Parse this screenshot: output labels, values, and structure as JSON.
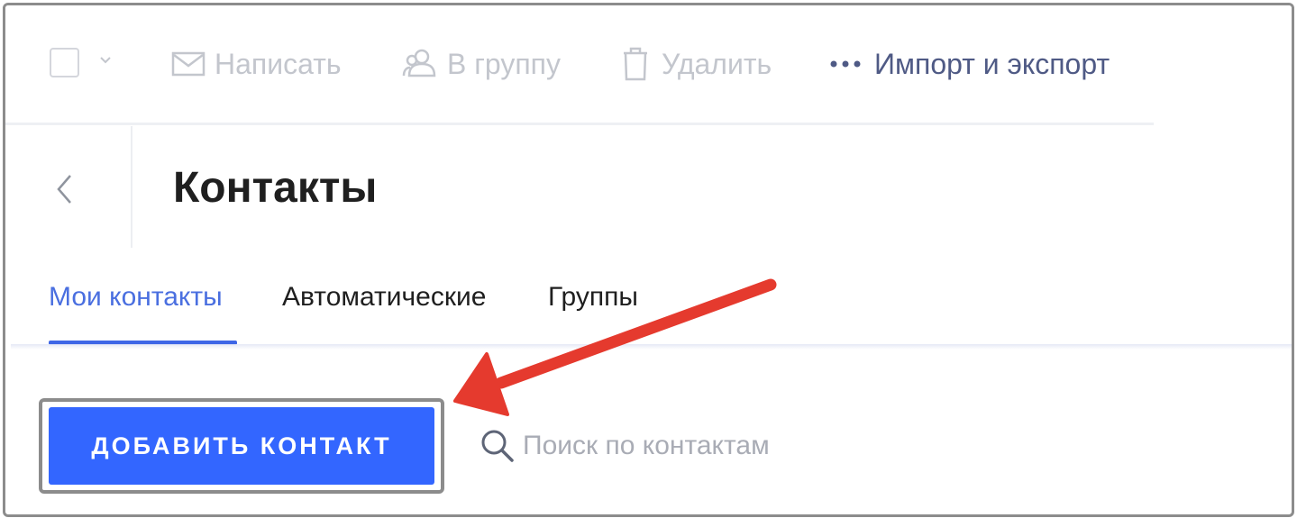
{
  "toolbar": {
    "compose_label": "Написать",
    "to_group_label": "В группу",
    "delete_label": "Удалить",
    "import_export_label": "Импорт и экспорт"
  },
  "header": {
    "title": "Контакты"
  },
  "tabs": [
    {
      "label": "Мои контакты",
      "active": true
    },
    {
      "label": "Автоматические",
      "active": false
    },
    {
      "label": "Группы",
      "active": false
    }
  ],
  "actions": {
    "add_contact_label": "ДОБАВИТЬ КОНТАКТ"
  },
  "search": {
    "placeholder": "Поиск по контактам",
    "value": ""
  },
  "icons": {
    "compose": "envelope-icon",
    "to_group": "people-icon",
    "delete": "trash-icon",
    "more": "more-dots-icon",
    "back": "chevron-left-icon",
    "search": "search-icon",
    "select_dropdown": "chevron-down-icon"
  },
  "colors": {
    "accent": "#3366ff",
    "active_tab": "#4a6fe0",
    "disabled": "#c3c6cd",
    "link": "#4f5a85",
    "annotation_arrow": "#e53a2e"
  }
}
